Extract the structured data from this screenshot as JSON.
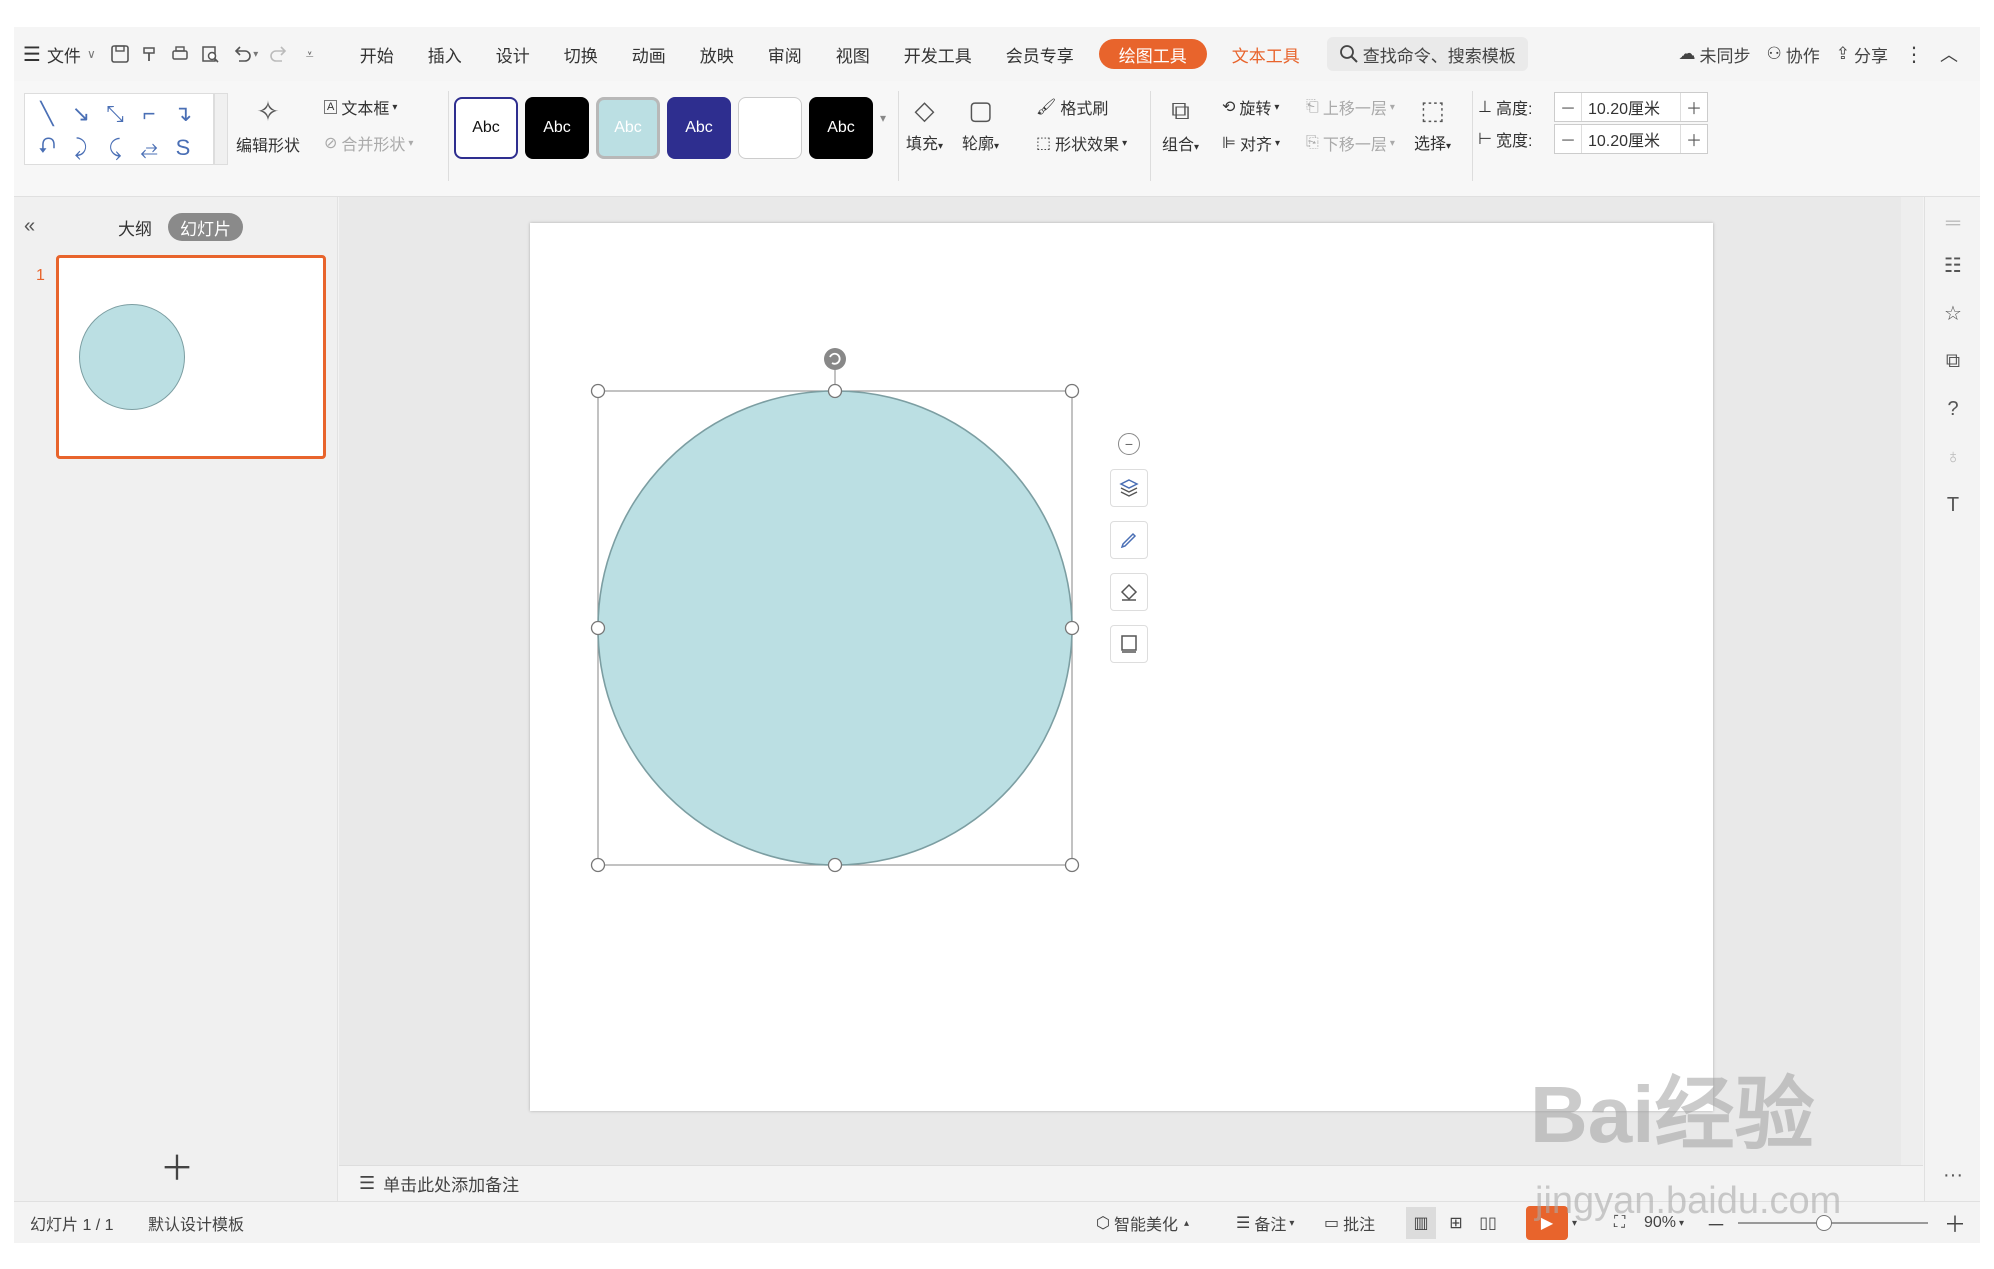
{
  "menubar": {
    "file_label": "文件",
    "tabs": [
      "开始",
      "插入",
      "设计",
      "切换",
      "动画",
      "放映",
      "审阅",
      "视图",
      "开发工具",
      "会员专享"
    ],
    "active_tab": "绘图工具",
    "text_tools_tab": "文本工具",
    "search_text": "查找命令、搜索模板",
    "sync_label": "未同步",
    "collab_label": "协作",
    "share_label": "分享"
  },
  "ribbon": {
    "edit_shape": "编辑形状",
    "textbox": "文本框",
    "merge_shape": "合并形状",
    "style_label": "Abc",
    "fill": "填充",
    "outline": "轮廓",
    "format_painter": "格式刷",
    "shape_effect": "形状效果",
    "group": "组合",
    "rotate": "旋转",
    "align": "对齐",
    "bring_forward": "上移一层",
    "send_backward": "下移一层",
    "select": "选择",
    "height_label": "高度:",
    "height_value": "10.20厘米",
    "width_label": "宽度:",
    "width_value": "10.20厘米",
    "minus": "－",
    "plus": "＋"
  },
  "leftpane": {
    "outline_tab": "大纲",
    "slides_tab": "幻灯片",
    "slide_number": "1"
  },
  "notes": {
    "placeholder": "单击此处添加备注"
  },
  "statusbar": {
    "slide_info": "幻灯片 1 / 1",
    "template": "默认设计模板",
    "beautify": "智能美化",
    "notes": "备注",
    "comments": "批注",
    "zoom": "90%",
    "zoom_fraction": 0.45
  },
  "colors": {
    "accent": "#e8642c",
    "shape_fill": "#bbdfe3",
    "shape_stroke": "#7c9ea2",
    "style_navy": "#2e2e8f"
  },
  "watermark": {
    "brand": "Bai经验",
    "url": "jingyan.baidu.com"
  }
}
